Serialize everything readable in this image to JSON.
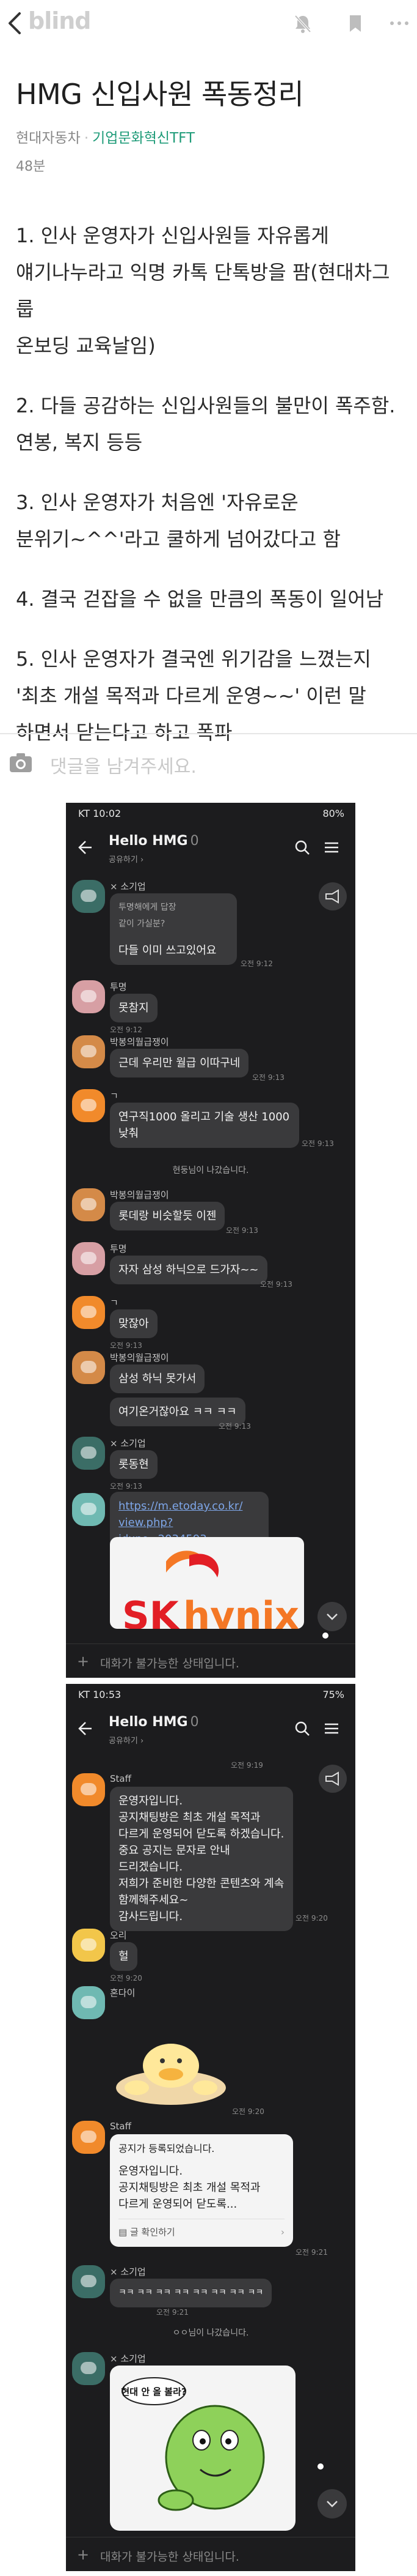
{
  "topbar": {
    "brand": "blind",
    "icons": [
      "back-chevron-icon",
      "bell-off-icon",
      "bookmark-icon",
      "more-icon"
    ]
  },
  "post": {
    "title": "HMG 신입사원 폭동정리",
    "company": "현대자동차",
    "topic": "기업문화혁신TFT",
    "time": "48분",
    "paragraphs": [
      [
        "1. 인사 운영자가 신입사원들 자유롭게",
        "얘기나누라고 익명 카톡 단톡방을 팜(현대차그룹",
        "온보딩 교육날임)"
      ],
      [
        "2. 다들 공감하는 신입사원들의 불만이 폭주함.",
        "연봉, 복지 등등"
      ],
      [
        "3. 인사 운영자가 처음엔 '자유로운",
        "분위기~^^'라고 쿨하게 넘어갔다고 함"
      ],
      [
        "4. 결국 걷잡을 수 없을 만큼의 폭동이 일어남"
      ],
      [
        "5. 인사 운영자가 결국엔 위기감을 느꼈는지",
        "'최초 개설 목적과 다르게 운영~~' 이런 말",
        "하면서 닫는다고 하고 폭파"
      ]
    ]
  },
  "comment": {
    "placeholder": "댓글을 남겨주세요."
  },
  "shot1": {
    "status_left": "KT 10:02",
    "status_right": "80%",
    "chat_name": "Hello HMG",
    "member_count": "0",
    "chat_sub": "공유하기 ›",
    "input_placeholder": "대화가 불가능한 상태입니다.",
    "messages": [
      {
        "sender": "× 소기업",
        "reply_title": "투명해에게 답장",
        "reply_text": "같이 가실분?",
        "text": "다들 이미 쓰고있어요",
        "time": "오전 9:12"
      },
      {
        "sender": "투명",
        "text": "못참지",
        "time": "오전 9:12"
      },
      {
        "sender": "박봉의월급쟁이",
        "text": "근데 우리만 월급 이따구네",
        "time": "오전 9:13"
      },
      {
        "sender": "ㄱ",
        "text": [
          "연구직1000 올리고 기술 생산 1000",
          "낮춰"
        ],
        "time": "오전 9:13"
      },
      {
        "system": "현둥님이 나갔습니다."
      },
      {
        "sender": "박봉의월급쟁이",
        "text": "롯데랑 비슷할듯 이젠",
        "time": "오전 9:13"
      },
      {
        "sender": "투명",
        "text": "자자 삼성 하닉으로 드가자~~",
        "time": "오전 9:13"
      },
      {
        "sender": "ㄱ",
        "text": "맞잖아",
        "time": "오전 9:13"
      },
      {
        "sender": "박봉의월급쟁이",
        "text": "삼성 하닉 못가서",
        "time": ""
      },
      {
        "sender": "",
        "text": "여기온거잖아요 ㅋㅋ ㅋㅋ",
        "time": "오전 9:13"
      },
      {
        "sender": "× 소기업",
        "text": "롯동현",
        "time": "오전 9:13"
      },
      {
        "sender": "",
        "link": [
          "https://m.etoday.co.kr/",
          "view.php?idxno=2034593"
        ],
        "time": ""
      },
      {
        "preview_logo": [
          "SK",
          "hynix"
        ]
      }
    ]
  },
  "shot2": {
    "status_left": "KT 10:53",
    "status_right": "75%",
    "chat_name": "Hello HMG",
    "member_count": "0",
    "chat_sub": "공유하기 ›",
    "input_placeholder": "대화가 불가능한 상태입니다.",
    "top_time": "오전 9:19",
    "messages": [
      {
        "sender": "Staff",
        "text": [
          "운영자입니다.",
          "공지채팅방은 최초 개설 목적과",
          "다르게 운영되어 닫도록 하겠습니다.",
          "중요 공지는 문자로 안내",
          "드리겠습니다.",
          "저희가 준비한 다양한 콘텐츠와 계속",
          "함께해주세요~",
          "감사드립니다."
        ],
        "time": "오전 9:20"
      },
      {
        "sender": "오리",
        "text": "헐",
        "time": "오전 9:20"
      },
      {
        "sender": "혼다이",
        "sticker": "sticker-duck",
        "time": "오전 9:20"
      },
      {
        "sender": "Staff",
        "notice_head": "공지가 등록되었습니다.",
        "text": [
          "운영자입니다.",
          "공지채팅방은 최초 개설 목적과",
          "다르게 운영되어 닫도록..."
        ],
        "footer": "글 확인하기",
        "time": "오전 9:21"
      },
      {
        "sender": "× 소기업",
        "text": "ㅋㅋ ㅋㅋ ㅋㅋ ㅋㅋ ㅋㅋ ㅋㅋ ㅋㅋ ㅋㅋ",
        "time": "오전 9:21"
      },
      {
        "system": "ㅇㅇ님이 나갔습니다."
      },
      {
        "sender": "× 소기업",
        "sticker_text": "현대 안 올 볼라?"
      }
    ]
  }
}
